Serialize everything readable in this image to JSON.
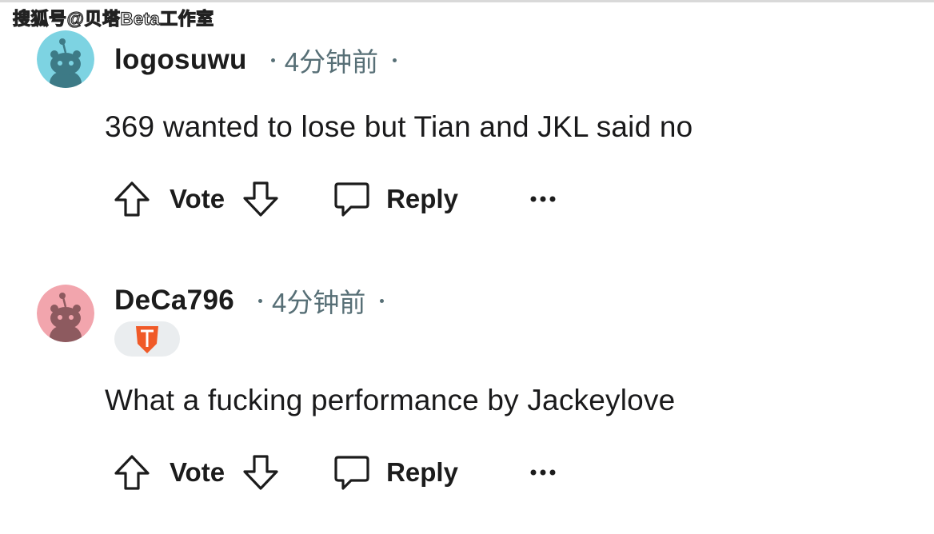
{
  "watermark": "搜狐号@贝塔Beta工作室",
  "comments": [
    {
      "username": "logosuwu",
      "time": "4分钟前",
      "body": "369 wanted to lose but Tian and JKL said no",
      "avatar_color": "#7dd3e2",
      "has_flair": false,
      "actions": {
        "vote_label": "Vote",
        "reply_label": "Reply"
      }
    },
    {
      "username": "DeCa796",
      "time": "4分钟前",
      "body": "What a fucking performance by Jackeylove",
      "avatar_color": "#f2a5ad",
      "has_flair": true,
      "flair_icon": "team-logo-icon",
      "actions": {
        "vote_label": "Vote",
        "reply_label": "Reply"
      }
    }
  ],
  "icons": {
    "upvote": "arrow-up-icon",
    "downvote": "arrow-down-icon",
    "reply": "speech-bubble-icon",
    "more": "ellipsis-icon"
  }
}
